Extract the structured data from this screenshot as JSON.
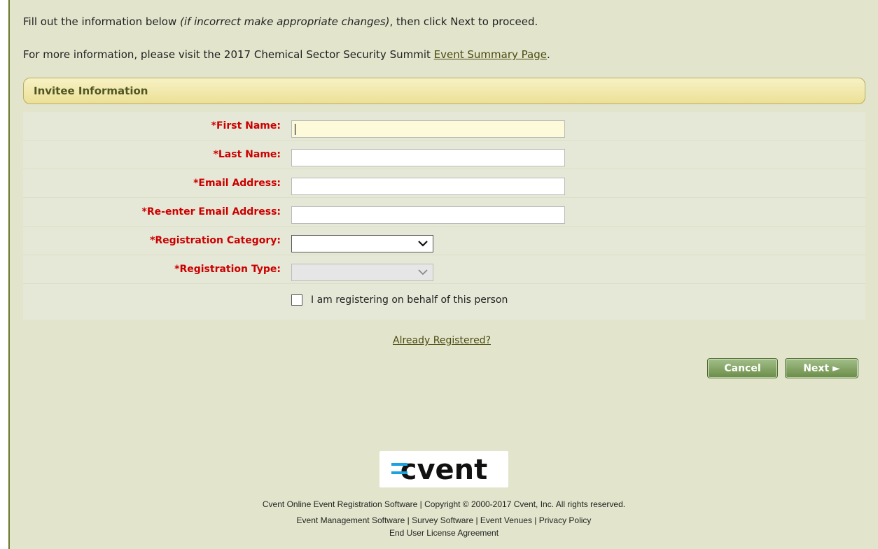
{
  "intro": {
    "line1_before": "Fill out the information below ",
    "line1_italic": "(if incorrect make appropriate changes)",
    "line1_after": ", then click Next to proceed.",
    "line2_before": "For more information, please visit the 2017 Chemical Sector Security Summit ",
    "line2_link": "Event Summary Page",
    "line2_after": "."
  },
  "section": {
    "title": "Invitee Information"
  },
  "form": {
    "first_name_label": "*First Name:",
    "last_name_label": "*Last Name:",
    "email_label": "*Email Address:",
    "reenter_email_label": "*Re-enter Email Address:",
    "reg_category_label": "*Registration Category:",
    "reg_type_label": "*Registration Type:",
    "behalf_label": "I am registering on behalf of this person"
  },
  "links": {
    "already_registered": "Already Registered?"
  },
  "buttons": {
    "cancel": "Cancel",
    "next": "Next ►"
  },
  "footer": {
    "logo_text": "cvent",
    "line1": "Cvent Online Event Registration Software | Copyright © 2000-2017 Cvent, Inc. All rights reserved.",
    "line2": "Event Management Software | Survey Software | Event Venues | Privacy Policy",
    "line3": "End User License Agreement"
  },
  "colors": {
    "required_label": "#cc0000",
    "page_bg": "#e2e5cc",
    "button_green": "#6a8d47"
  }
}
